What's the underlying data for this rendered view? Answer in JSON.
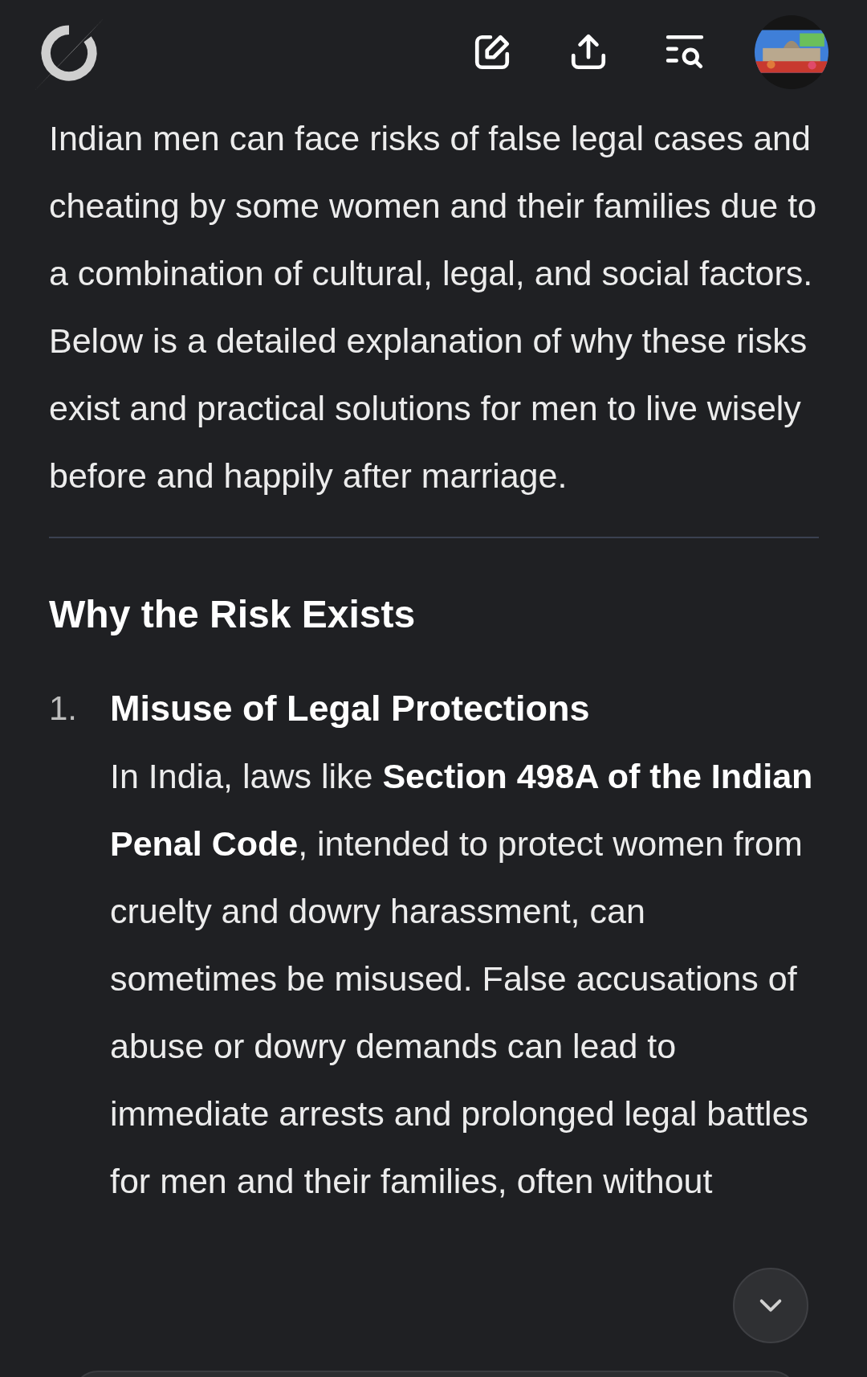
{
  "intro": "Indian men can face risks of false legal cases and cheating by some women and their families due to a combination of cultural, legal, and social factors. Below is a detailed explanation of why these risks exist and practical solutions for men to live wisely before and happily after marriage.",
  "section": {
    "heading": "Why the Risk Exists",
    "items": [
      {
        "number": "1.",
        "title": "Misuse of Legal Protections",
        "body": "In India, laws like **Section 498A of the Indian Penal Code**, intended to protect women from cruelty and dowry harassment, can sometimes be misused. False accusations of abuse or dowry demands can lead to immediate arrests and prolonged legal battles for men and their families, often without"
      }
    ]
  }
}
